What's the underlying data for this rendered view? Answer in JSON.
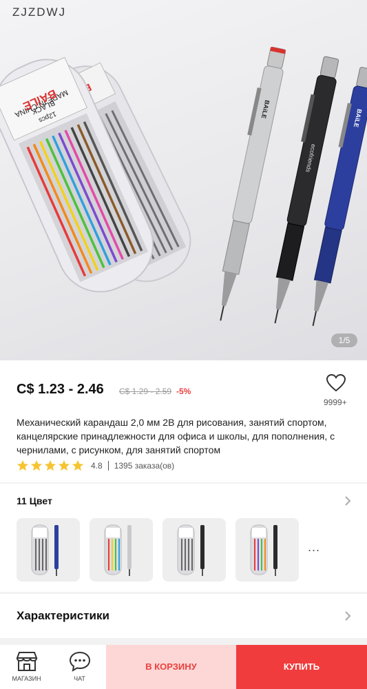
{
  "hero": {
    "store_name": "ZJZDWJ",
    "counter": "1/5",
    "box_text_front": "BAiLE",
    "box_text_back": "BAiLE",
    "box_label_black": "BLACK",
    "box_label_pcs": "12pcs",
    "box_label_made": "MADE IN CHINA",
    "box_model": "BL-6Z1",
    "box_size": "2.0X90mm",
    "pencil_brand": "BAiLE",
    "pencil_series": "ecofriends"
  },
  "price": {
    "current": "C$ 1.23 - 2.46",
    "old": "C$ 1.29 - 2.59",
    "discount": "-5%",
    "wish_count": "9999+"
  },
  "product": {
    "title": "Механический карандаш 2,0 мм 2B для рисования, занятий спортом, канцелярские принадлежности для офиса и школы, для пополнения, с чернилами, с рисунком, для занятий спортом",
    "rating": "4.8",
    "orders": "1395 заказа(ов)",
    "stars": 5
  },
  "colors": {
    "title": "11 Цвет",
    "more": "..."
  },
  "specs": {
    "title": "Характеристики"
  },
  "bottom": {
    "store_label": "МАГАЗИН",
    "chat_label": "ЧАТ",
    "cart_label": "В КОРЗИНУ",
    "buy_label": "КУПИТЬ"
  },
  "theme": {
    "accent": "#e8413e",
    "star": "#f6c431",
    "buy_bg": "#f03c3c",
    "cart_bg": "#fdd7d6"
  }
}
